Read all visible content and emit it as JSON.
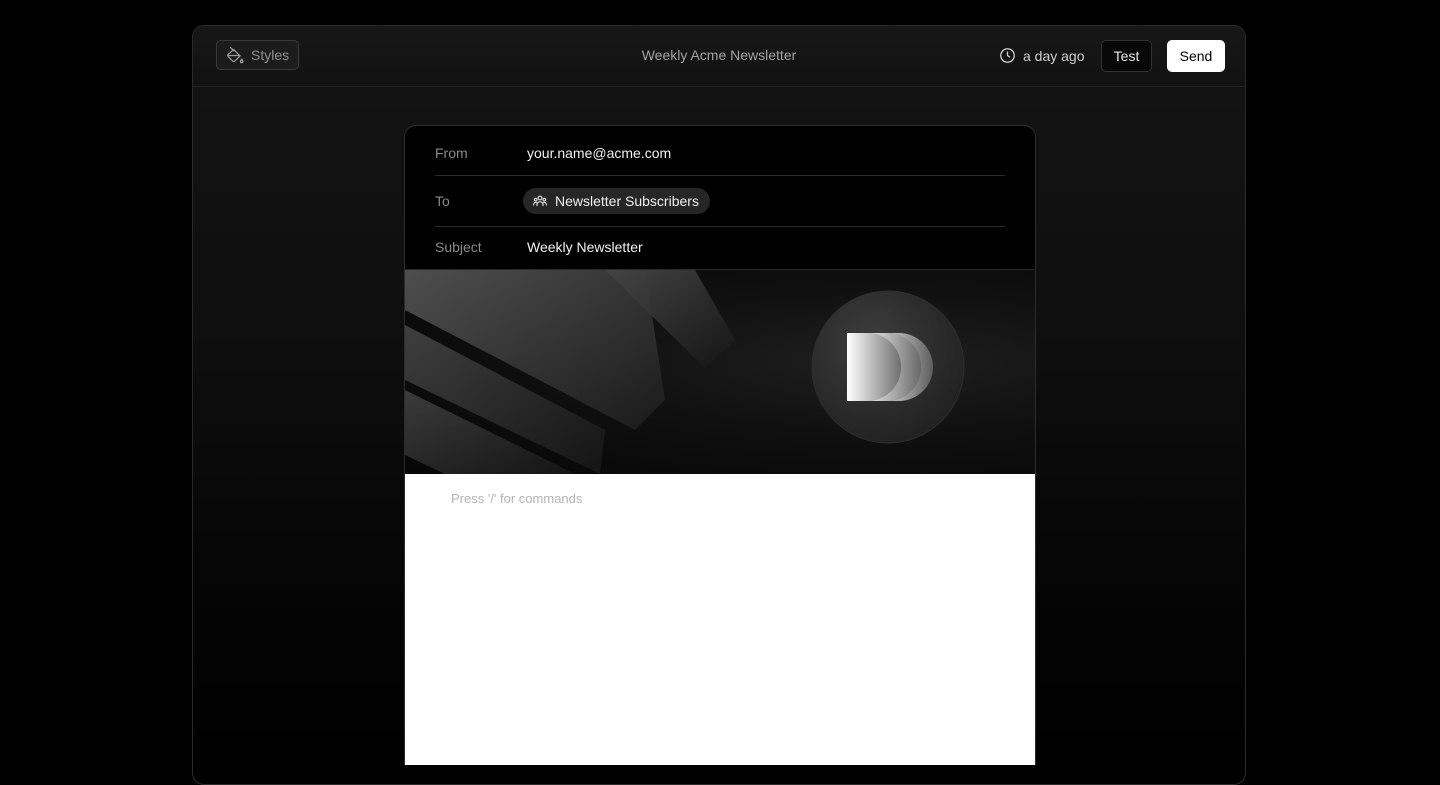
{
  "toolbar": {
    "styles_label": "Styles",
    "title": "Weekly Acme Newsletter",
    "saved_time": "a day ago",
    "test_label": "Test",
    "send_label": "Send"
  },
  "email": {
    "from_label": "From",
    "from_value": "your.name@acme.com",
    "to_label": "To",
    "to_value": "Newsletter Subscribers",
    "subject_label": "Subject",
    "subject_value": "Weekly Newsletter"
  },
  "banner": {
    "logo_icon": "fast-forward-logo-icon",
    "background": "#0a0a0a"
  },
  "editor": {
    "placeholder": "Press '/' for commands",
    "background": "#ffffff"
  },
  "colors": {
    "send_button": "#ffffff",
    "page_background": "#000000"
  }
}
